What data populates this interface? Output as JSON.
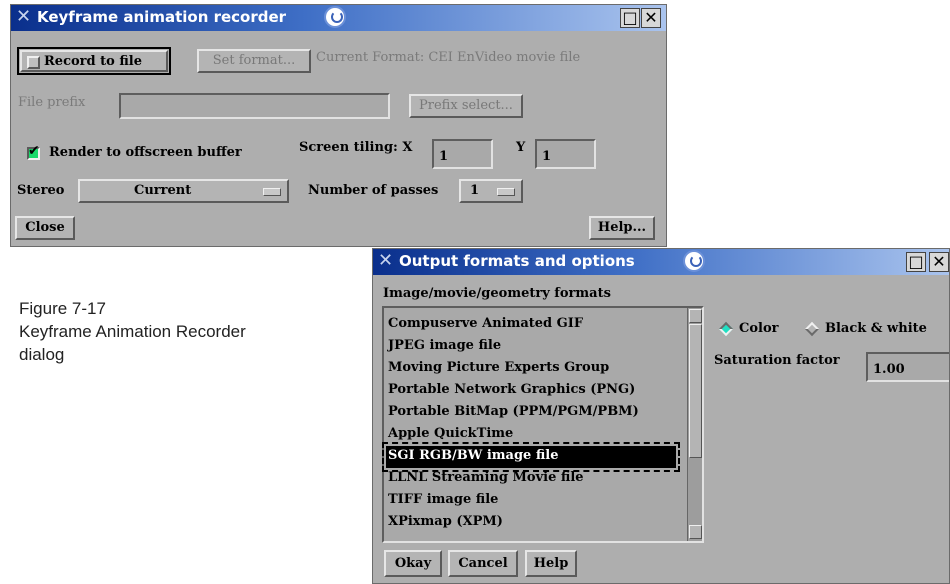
{
  "recorder": {
    "title": "Keyframe animation recorder",
    "record_to_file": "Record to file",
    "set_format": "Set format...",
    "current_format": "Current Format: CEI EnVideo movie file",
    "file_prefix_label": "File prefix",
    "file_prefix_value": "",
    "prefix_select": "Prefix select...",
    "render_offscreen": "Render to offscreen buffer",
    "render_offscreen_checked": true,
    "screen_tiling_label": "Screen tiling: X",
    "tiling_x": "1",
    "tiling_y_label": "Y",
    "tiling_y": "1",
    "stereo_label": "Stereo",
    "stereo_value": "Current",
    "passes_label": "Number of passes",
    "passes_value": "1",
    "close": "Close",
    "help": "Help..."
  },
  "caption": {
    "line1": "Figure 7-17",
    "line2": "Keyframe Animation Recorder",
    "line3": "dialog"
  },
  "formats": {
    "title": "Output formats and options",
    "list_label": "Image/movie/geometry formats",
    "items": [
      "Compuserve Animated GIF",
      "JPEG image file",
      "Moving Picture Experts Group",
      "Portable Network Graphics (PNG)",
      "Portable BitMap (PPM/PGM/PBM)",
      "Apple QuickTime",
      "SGI RGB/BW image file",
      "LLNL Streaming Movie file",
      "TIFF image file",
      "XPixmap (XPM)"
    ],
    "selected": "SGI RGB/BW image file",
    "color_option": "Color",
    "bw_option": "Black & white",
    "color_mode": "Color",
    "saturation_label": "Saturation factor",
    "saturation_value": "1.00",
    "okay": "Okay",
    "cancel": "Cancel",
    "help": "Help"
  },
  "colors": {
    "title_bar": "#0a2f8c",
    "window_bg": "#aeaeae",
    "checkbox_on": "#1ad86a",
    "radio_on": "#1fe0c3"
  },
  "icons": [
    "x-window-icon",
    "swirl-icon",
    "maximize-icon",
    "close-icon"
  ]
}
